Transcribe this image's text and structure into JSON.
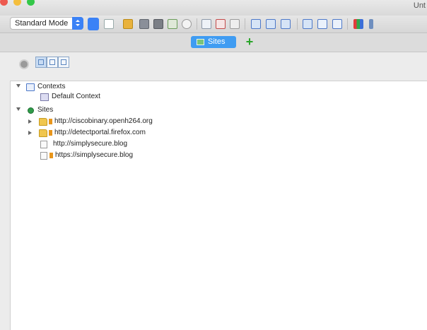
{
  "window": {
    "title": "Unt",
    "traffic_lights": {
      "close": "#ed5a50",
      "minimize": "#f4be3d",
      "zoom": "#33c748"
    }
  },
  "toolbar": {
    "mode_label": "Standard Mode",
    "icons": [
      "new-session-icon",
      "open-session-icon",
      "save-session-icon",
      "snapshot-icon",
      "session-properties-icon",
      "options-icon",
      "show-tab-icon",
      "hide-tab-icon",
      "report-icon",
      "layout-icon",
      "expand-icon",
      "panel-icon",
      "full-layout-icon",
      "split-icon",
      "tabs-icon",
      "scan-policy-icon"
    ]
  },
  "tabs": {
    "active": {
      "label": "Sites",
      "icon": "sites-tab-icon"
    },
    "add_icon": "add-tab-icon"
  },
  "panel_tools": {
    "icons": [
      "gear-icon",
      "show-only-scope-icon",
      "link-with-history-icon",
      "new-context-icon"
    ]
  },
  "tree": {
    "contexts": {
      "label": "Contexts",
      "children": [
        {
          "label": "Default Context"
        }
      ]
    },
    "sites": {
      "label": "Sites",
      "children": [
        {
          "label": "http://ciscobinary.openh264.org",
          "type": "folder",
          "expandable": true
        },
        {
          "label": "http://detectportal.firefox.com",
          "type": "folder",
          "expandable": true
        },
        {
          "label": "http://simplysecure.blog",
          "type": "page",
          "expandable": false
        },
        {
          "label": "https://simplysecure.blog",
          "type": "page",
          "expandable": false
        }
      ]
    }
  }
}
